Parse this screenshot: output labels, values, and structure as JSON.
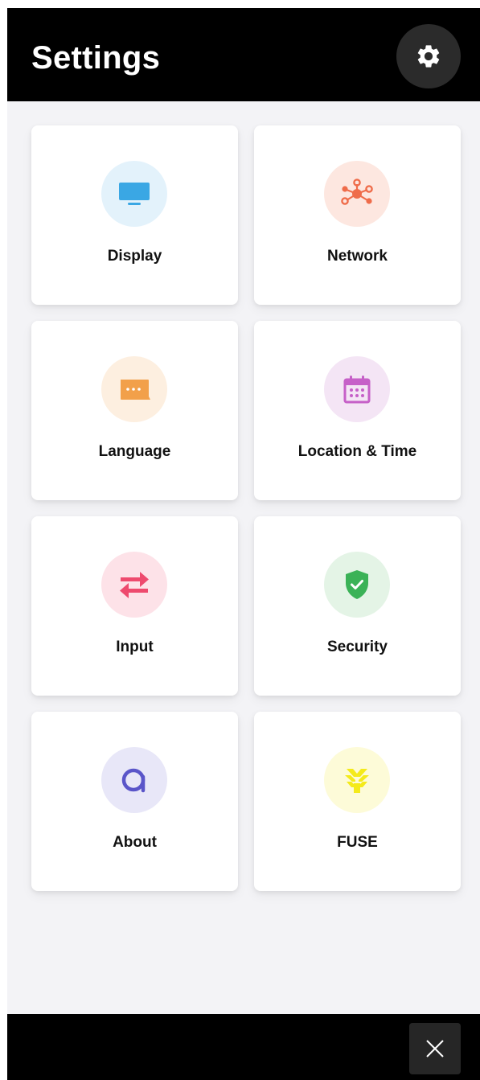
{
  "header": {
    "title": "Settings",
    "settings_icon": "gear-icon"
  },
  "tiles": [
    {
      "label": "Display",
      "icon": "monitor-icon",
      "icon_color": "#3aa7e4",
      "icon_bg": "#e3f2fb"
    },
    {
      "label": "Network",
      "icon": "network-icon",
      "icon_color": "#ef6c4a",
      "icon_bg": "#fde7e0"
    },
    {
      "label": "Language",
      "icon": "chat-bubble-icon",
      "icon_color": "#f2a04a",
      "icon_bg": "#fdefe0"
    },
    {
      "label": "Location & Time",
      "icon": "calendar-icon",
      "icon_color": "#c660c8",
      "icon_bg": "#f4e5f5"
    },
    {
      "label": "Input",
      "icon": "swap-arrows-icon",
      "icon_color": "#ee4a6e",
      "icon_bg": "#fde2e8"
    },
    {
      "label": "Security",
      "icon": "shield-check-icon",
      "icon_color": "#3bb257",
      "icon_bg": "#e4f4e6"
    },
    {
      "label": "About",
      "icon": "about-a-icon",
      "icon_color": "#5a55c9",
      "icon_bg": "#e8e7f8"
    },
    {
      "label": "FUSE",
      "icon": "fuse-logo-icon",
      "icon_color": "#f4ea1b",
      "icon_bg": "#fdfbd8"
    }
  ],
  "footer": {
    "close_icon": "close-icon"
  }
}
